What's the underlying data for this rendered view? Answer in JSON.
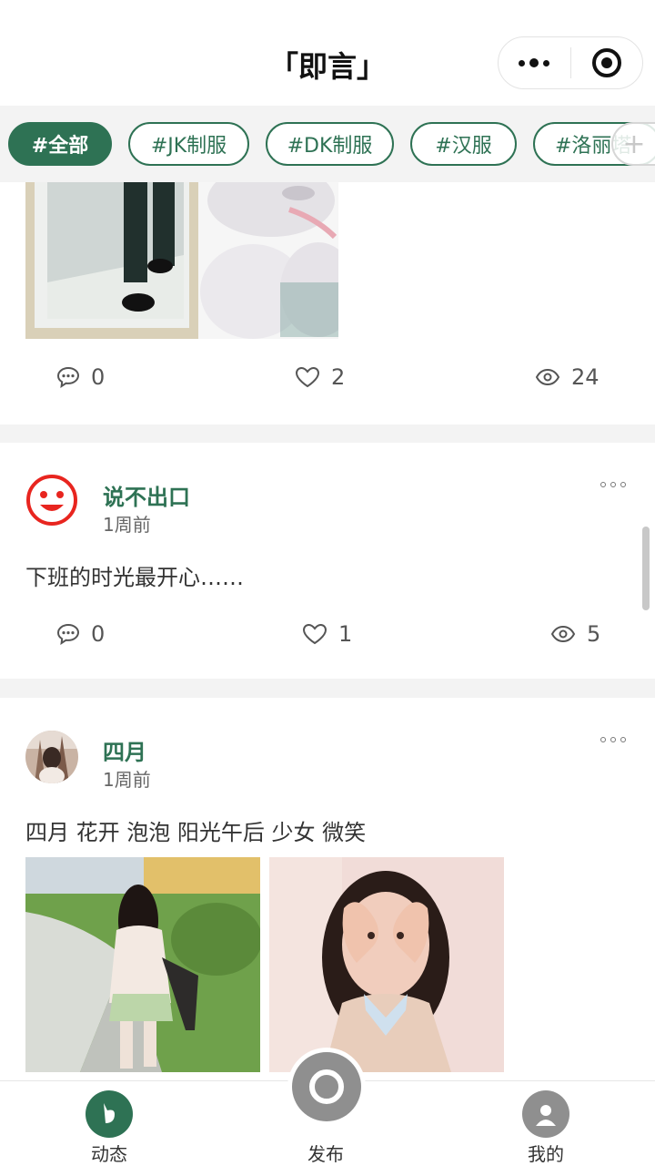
{
  "header": {
    "title": "「即言」"
  },
  "tags": {
    "items": [
      "#全部",
      "#JK制服",
      "#DK制服",
      "#汉服",
      "#洛丽塔"
    ],
    "add_label": "+"
  },
  "posts": [
    {
      "stats": {
        "comments": "0",
        "likes": "2",
        "views": "24"
      }
    },
    {
      "username": "说不出口",
      "time": "1周前",
      "content": "下班的时光最开心……",
      "stats": {
        "comments": "0",
        "likes": "1",
        "views": "5"
      }
    },
    {
      "username": "四月",
      "time": "1周前",
      "content": "四月 花开 泡泡 阳光午后 少女 微笑"
    }
  ],
  "tabbar": {
    "feed_label": "动态",
    "publish_label": "发布",
    "mine_label": "我的"
  },
  "colors": {
    "accent": "#2e7254",
    "smiley": "#e8251f"
  }
}
